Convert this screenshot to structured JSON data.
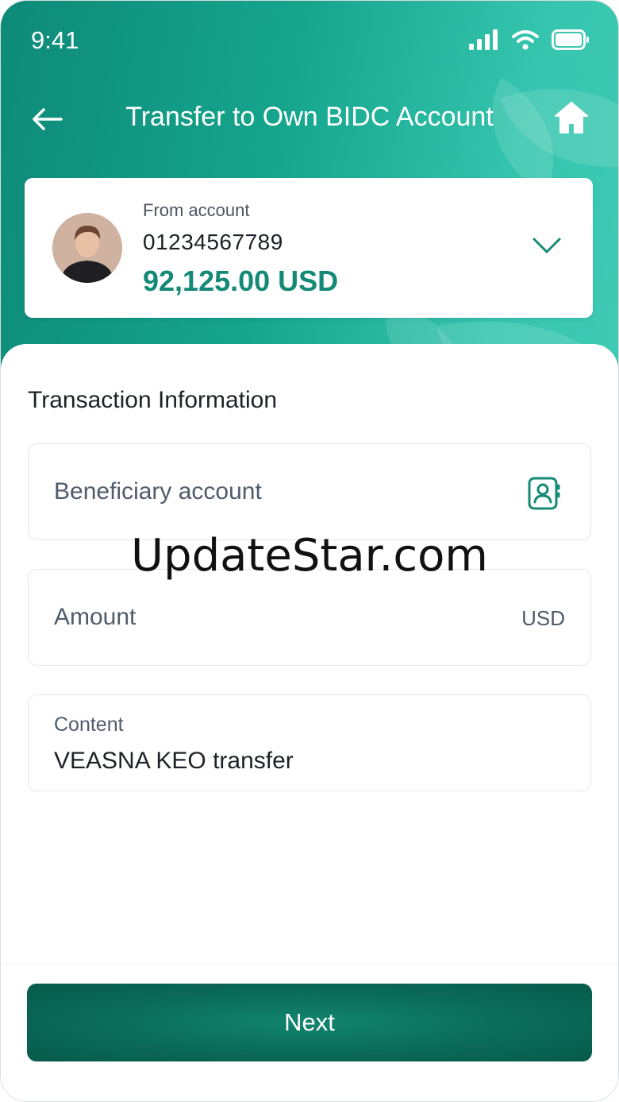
{
  "status_bar": {
    "time": "9:41"
  },
  "header": {
    "title": "Transfer to Own BIDC Account"
  },
  "from_account": {
    "label": "From account",
    "number": "01234567789",
    "balance": "92,125.00 USD"
  },
  "transaction": {
    "section_title": "Transaction Information",
    "beneficiary": {
      "placeholder": "Beneficiary account"
    },
    "amount": {
      "placeholder": "Amount",
      "currency": "USD"
    },
    "content": {
      "label": "Content",
      "value": "VEASNA KEO transfer"
    }
  },
  "footer": {
    "next_label": "Next"
  },
  "watermark": "UpdateStar.com",
  "icons": {
    "back": "arrow-left-icon",
    "home": "home-icon",
    "dropdown": "chevron-down-icon",
    "contacts": "contact-book-icon",
    "signal": "signal-icon",
    "wifi": "wifi-icon",
    "battery": "battery-icon"
  },
  "colors": {
    "brand": "#148a76",
    "header_gradient_start": "#0d8a78",
    "header_gradient_end": "#3fcab4",
    "button": "#0a6a58"
  }
}
